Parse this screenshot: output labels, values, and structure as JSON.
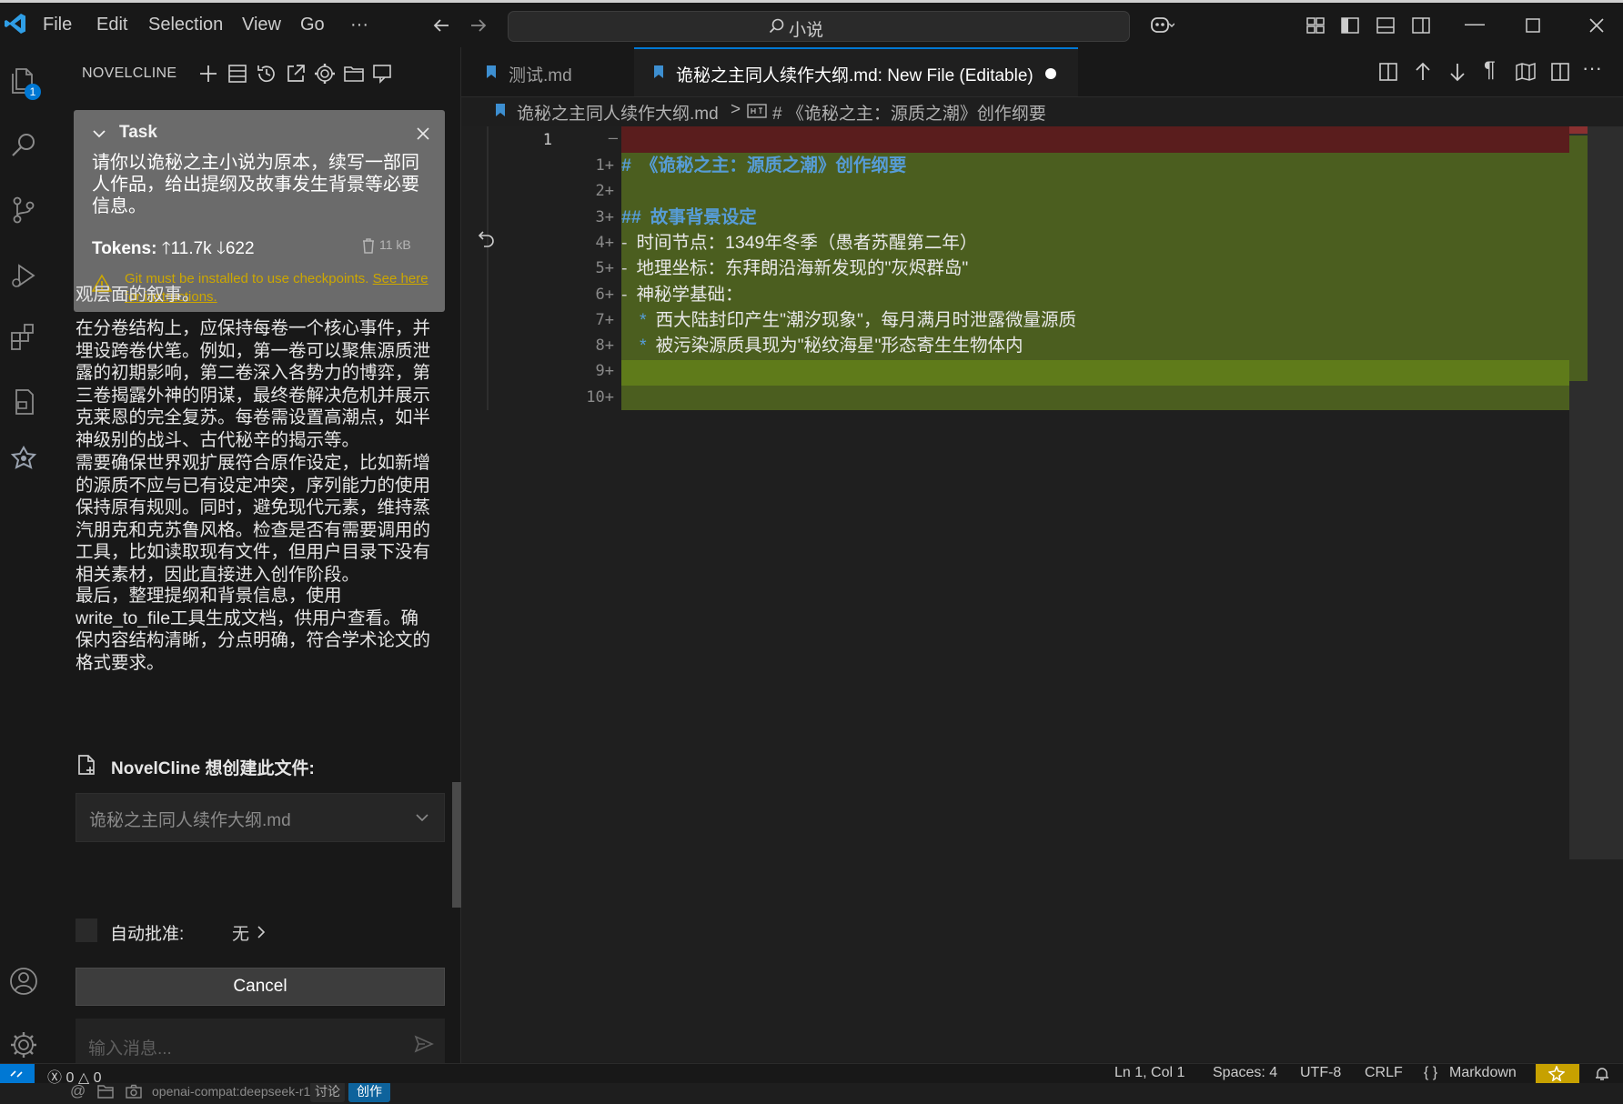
{
  "titlebar": {
    "menus": [
      "File",
      "Edit",
      "Selection",
      "View",
      "Go",
      "···"
    ],
    "search": "小说"
  },
  "sidebar": {
    "title": "NOVELCLINE",
    "task": {
      "header": "Task",
      "text": "请你以诡秘之主小说为原本，续写一部同人作品，给出提纲及故事发生背景等必要信息。",
      "tokens_label": "Tokens:",
      "tokens_up": "11.7k",
      "tokens_down": "622",
      "size": "11 kB",
      "warning": "Git must be installed to use checkpoints.",
      "warning_link": "See here for instructions."
    },
    "chat": [
      "观层面的叙事。",
      "在分卷结构上，应保持每卷一个核心事件，并埋设跨卷伏笔。例如，第一卷可以聚焦源质泄露的初期影响，第二卷深入各势力的博弈，第三卷揭露外神的阴谋，最终卷解决危机并展示克莱恩的完全复苏。每卷需设置高潮点，如半神级别的战斗、古代秘辛的揭示等。",
      "需要确保世界观扩展符合原作设定，比如新增的源质不应与已有设定冲突，序列能力的使用保持原有规则。同时，避免现代元素，维持蒸汽朋克和克苏鲁风格。检查是否有需要调用的工具，比如读取现有文件，但用户目录下没有相关素材，因此直接进入创作阶段。",
      "最后，整理提纲和背景信息，使用write_to_file工具生成文档，供用户查看。确保内容结构清晰，分点明确，符合学术论文的格式要求。"
    ],
    "file_request_label": "NovelCline 想创建此文件:",
    "file_name": "诡秘之主同人续作大纲.md",
    "auto_approve_label": "自动批准:",
    "auto_approve_value": "无",
    "cancel_label": "Cancel",
    "input_placeholder": "输入消息...",
    "model": "openai-compat:deepseek-r1",
    "mode_discuss": "讨论",
    "mode_create": "创作"
  },
  "editor": {
    "tab1": "测试.md",
    "tab2": "诡秘之主同人续作大纲.md: New File (Editable)",
    "breadcrumb_file": "诡秘之主同人续作大纲.md",
    "breadcrumb_symbol": "# 《诡秘之主：源质之潮》创作纲要",
    "old_line_no": "1",
    "new_line_nos": [
      "1+",
      "2+",
      "3+",
      "4+",
      "5+",
      "6+",
      "7+",
      "8+",
      "9+",
      "10+"
    ],
    "lines": [
      {
        "marker": "#",
        "text": "《诡秘之主：源质之潮》创作纲要"
      },
      {
        "marker": "",
        "text": ""
      },
      {
        "marker": "##",
        "text": "故事背景设定"
      },
      {
        "marker": "-",
        "text": "时间节点：1349年冬季（愚者苏醒第二年）"
      },
      {
        "marker": "-",
        "text": "地理坐标：东拜朗沿海新发现的\"灰烬群岛\""
      },
      {
        "marker": "-",
        "text": "神秘学基础："
      },
      {
        "marker": "*",
        "text": "西大陆封印产生\"潮汐现象\"，每月满月时泄露微量源质"
      },
      {
        "marker": "*",
        "text": "被污染源质具现为\"秘纹海星\"形态寄生生物体内"
      },
      {
        "marker": "",
        "text": ""
      },
      {
        "marker": "",
        "text": ""
      }
    ]
  },
  "statusbar": {
    "errors": "0",
    "warnings": "0",
    "position": "Ln 1, Col 1",
    "spaces": "Spaces: 4",
    "encoding": "UTF-8",
    "eol": "CRLF",
    "language": "Markdown"
  },
  "colors": {
    "accent": "#0078d4",
    "added_bg": "#4b5e1f",
    "removed_bg": "#5a1d1d",
    "heading": "#569cd6",
    "warning": "#cca700"
  }
}
